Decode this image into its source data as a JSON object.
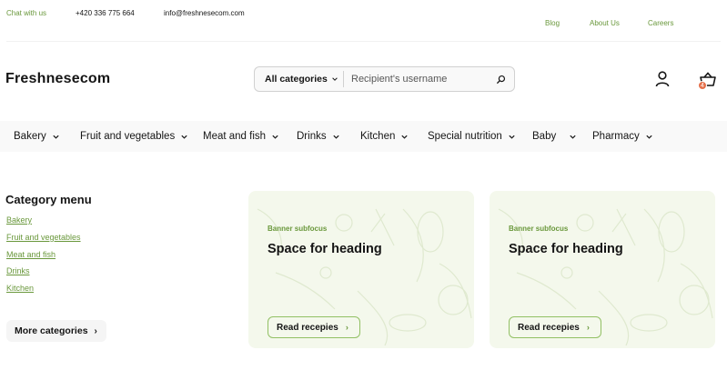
{
  "topbar": {
    "chat": "Chat with us",
    "phone": "+420 336 775 664",
    "email": "info@freshnesecom.com",
    "links": [
      "Blog",
      "About Us",
      "Careers"
    ]
  },
  "header": {
    "logo": "Freshnesecom",
    "search": {
      "category": "All categories",
      "placeholder": "Recipient's username"
    },
    "cart_badge": "4"
  },
  "nav": {
    "items": [
      "Bakery",
      "Fruit and vegetables",
      "Meat and fish",
      "Drinks",
      "Kitchen",
      "Special nutrition",
      "Baby",
      "Pharmacy"
    ]
  },
  "sidebar": {
    "title": "Category menu",
    "links": [
      "Bakery",
      "Fruit and vegetables",
      "Meat and fish",
      "Drinks",
      "Kitchen"
    ],
    "more_button": "More categories"
  },
  "banners": [
    {
      "subfocus": "Banner subfocus",
      "heading": "Space for heading",
      "button": "Read recepies"
    },
    {
      "subfocus": "Banner subfocus",
      "heading": "Space for heading",
      "button": "Read recepies"
    }
  ],
  "colors": {
    "accent": "#6a983c",
    "accent_light": "#92c064",
    "banner_bg": "#f4f8ec",
    "nav_bg": "#f9f9f9",
    "badge": "#e5704b"
  }
}
